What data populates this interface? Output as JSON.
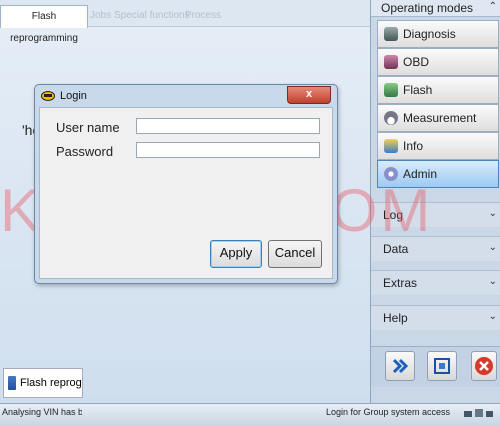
{
  "tabs": [
    "Flash reprogramming",
    "Jobs",
    "Special functions",
    "Process"
  ],
  "main": {
    "partial_label": "'he",
    "bottom_item": "Flash reprogram"
  },
  "watermark": "KEYECU.COM",
  "dialog": {
    "title": "Login",
    "close": "x",
    "username_label": "User name",
    "password_label": "Password",
    "username_value": "",
    "password_value": "",
    "apply": "Apply",
    "cancel": "Cancel"
  },
  "right_panel": {
    "header": "Operating modes",
    "modes": [
      {
        "label": "Diagnosis",
        "icon": "diagnosis-icon"
      },
      {
        "label": "OBD",
        "icon": "obd-icon"
      },
      {
        "label": "Flash",
        "icon": "flash-icon"
      },
      {
        "label": "Measurement",
        "icon": "measurement-icon"
      },
      {
        "label": "Info",
        "icon": "info-icon"
      },
      {
        "label": "Admin",
        "icon": "admin-icon",
        "selected": true
      }
    ],
    "sections": [
      "Log",
      "Data",
      "Extras",
      "Help"
    ]
  },
  "status": {
    "left": "Analysing VIN has been finished",
    "middle": "Login for Group system access"
  },
  "colors": {
    "watermark": "#e85a64",
    "selected_mode": "#9ccaf3",
    "close_button": "#c0402e"
  }
}
